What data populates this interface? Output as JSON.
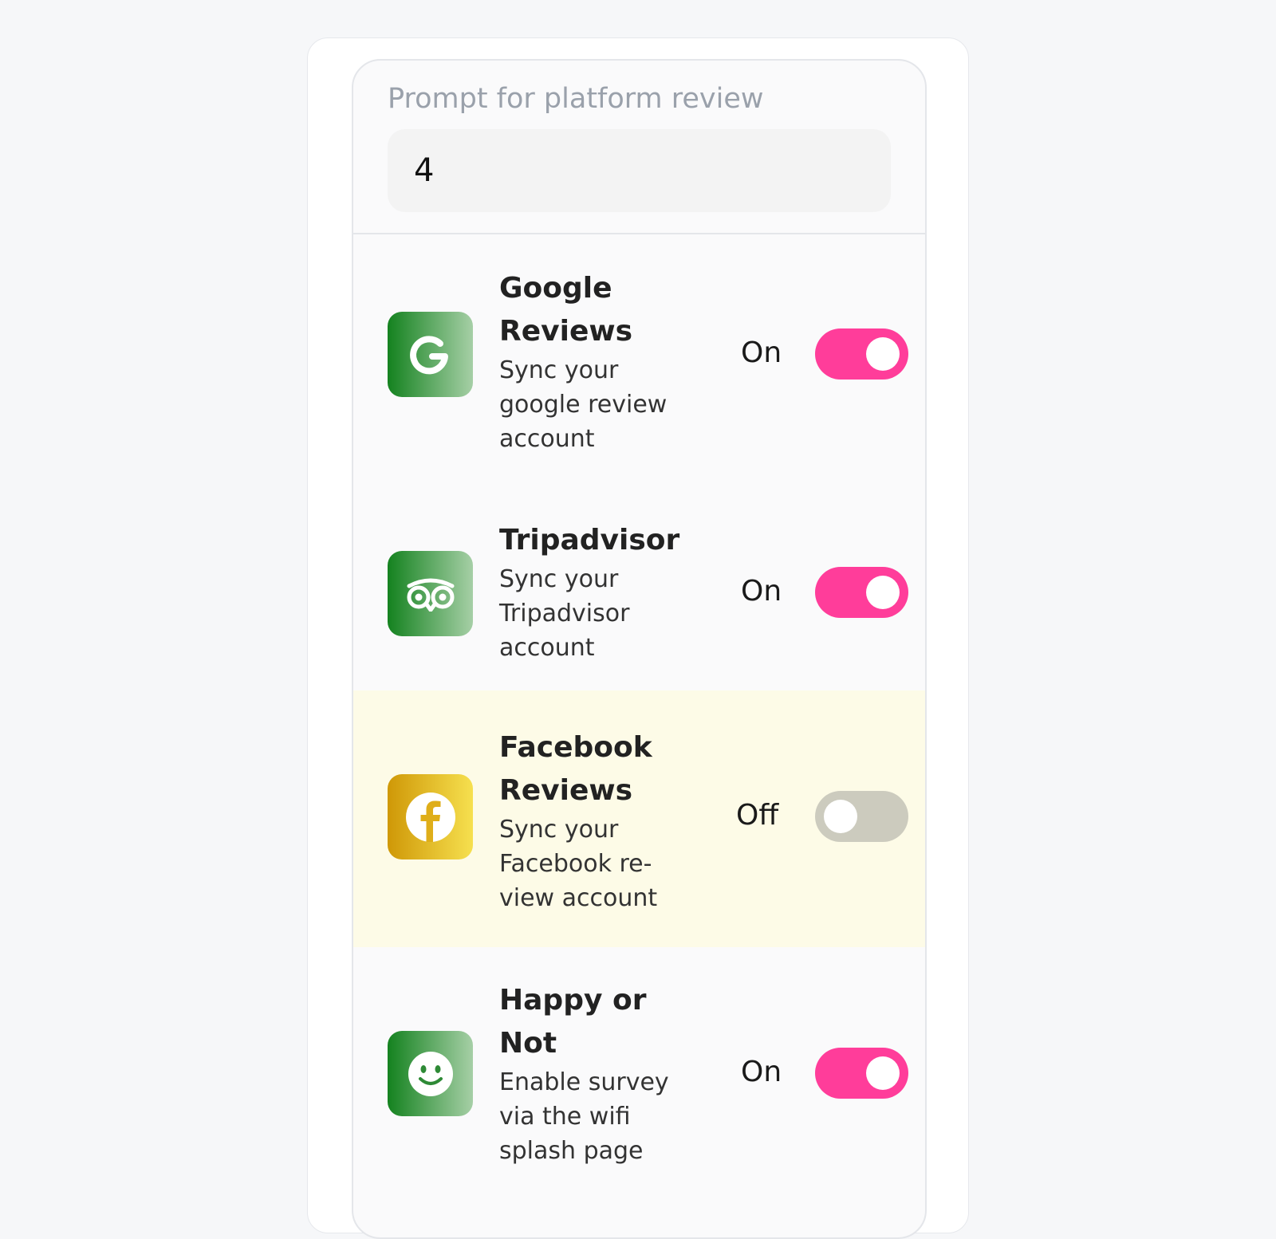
{
  "prompt": {
    "label": "Prompt for platform review",
    "value": "4"
  },
  "platforms": [
    {
      "title_line1": "Google",
      "title_line2": "Reviews",
      "desc": [
        "Sync your",
        "google review",
        "account"
      ],
      "status": "On",
      "enabled": true,
      "icon": "google-g-icon"
    },
    {
      "title_line1": "Tripadvisor",
      "desc": [
        "Sync your",
        "Tripadvisor",
        "account"
      ],
      "status": "On",
      "enabled": true,
      "icon": "tripadvisor-owl-icon"
    },
    {
      "title_line1": "Facebook",
      "title_line2": "Reviews",
      "desc": [
        "Sync your",
        "Facebook re-",
        "view account"
      ],
      "status": "Off",
      "enabled": false,
      "icon": "facebook-f-icon"
    },
    {
      "title_line1": "Happy or",
      "title_line2": "Not",
      "desc": [
        "Enable survey",
        "via the wifi",
        "splash page"
      ],
      "status": "On",
      "enabled": true,
      "icon": "smiley-face-icon"
    }
  ],
  "colors": {
    "toggle_on": "#ff3d9a",
    "toggle_off": "#cccbbe",
    "icon_green": "#14821f",
    "icon_gold": "#cf9807",
    "highlight_row": "#fdfbe7"
  }
}
